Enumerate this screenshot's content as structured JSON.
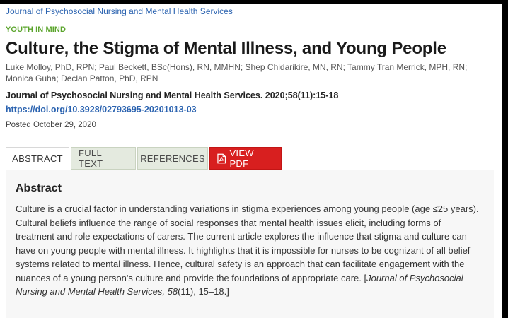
{
  "journal_link": "Journal of Psychosocial Nursing and Mental Health Services",
  "section_label": "YOUTH IN MIND",
  "title": "Culture, the Stigma of Mental Illness, and Young People",
  "authors": "Luke Molloy, PhD, RPN; Paul Beckett, BSc(Hons), RN, MMHN; Shep Chidarikire, MN, RN; Tammy Tran Merrick, MPH, RN; Monica Guha; Declan Patton, PhD, RPN",
  "citation": {
    "text": "Journal of Psychosocial Nursing and Mental Health Services. 2020;58(11):15-18",
    "doi": "https://doi.org/10.3928/02793695-20201013-03"
  },
  "posted": "Posted October 29, 2020",
  "tabs": {
    "abstract": "ABSTRACT",
    "full_text": "FULL TEXT",
    "references": "REFERENCES",
    "view_pdf": "VIEW PDF"
  },
  "abstract": {
    "heading": "Abstract",
    "body": "Culture is a crucial factor in understanding variations in stigma experiences among young people (age ≤25 years). Cultural beliefs influence the range of social responses that mental health issues elicit, including forms of treatment and role expectations of carers. The current article explores the influence that stigma and culture can have on young people with mental illness. It highlights that it is impossible for nurses to be cognizant of all belief systems related to mental illness. Hence, cultural safety is an approach that can facilitate engagement with the nuances of a young person's culture and provide the foundations of appropriate care. [",
    "ref_journal": "Journal of Psychosocial Nursing and Mental Health Services, 58",
    "ref_tail": "(11), 15–18.]"
  },
  "colors": {
    "link": "#2b63b0",
    "section": "#5aa42b",
    "pdf_tab": "#d81f1f",
    "tab_bg": "#e4eadf"
  }
}
